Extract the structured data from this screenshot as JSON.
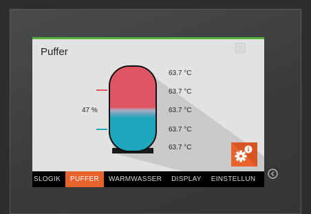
{
  "screen": {
    "title": "Puffer"
  },
  "buffer": {
    "fill_percent_label": "47 %",
    "temperatures": [
      "63.7 °C",
      "63.7 °C",
      "63.7 °C",
      "63.7 °C",
      "63.7 °C"
    ]
  },
  "tabs": [
    {
      "label": "SLOGIK",
      "active": false
    },
    {
      "label": "PUFFER",
      "active": true
    },
    {
      "label": "WARMWASSER",
      "active": false
    },
    {
      "label": "DISPLAY",
      "active": false
    },
    {
      "label": "EINSTELLUN",
      "active": false
    }
  ],
  "icons": {
    "settings": "gear-with-info-badge-icon",
    "menu": "menu-icon",
    "back": "back-circle-icon"
  },
  "colors": {
    "accent": "#e8632b",
    "status_bar": "#58b13a",
    "hot_water": "#e05563",
    "cold_water": "#1ea6bd"
  }
}
